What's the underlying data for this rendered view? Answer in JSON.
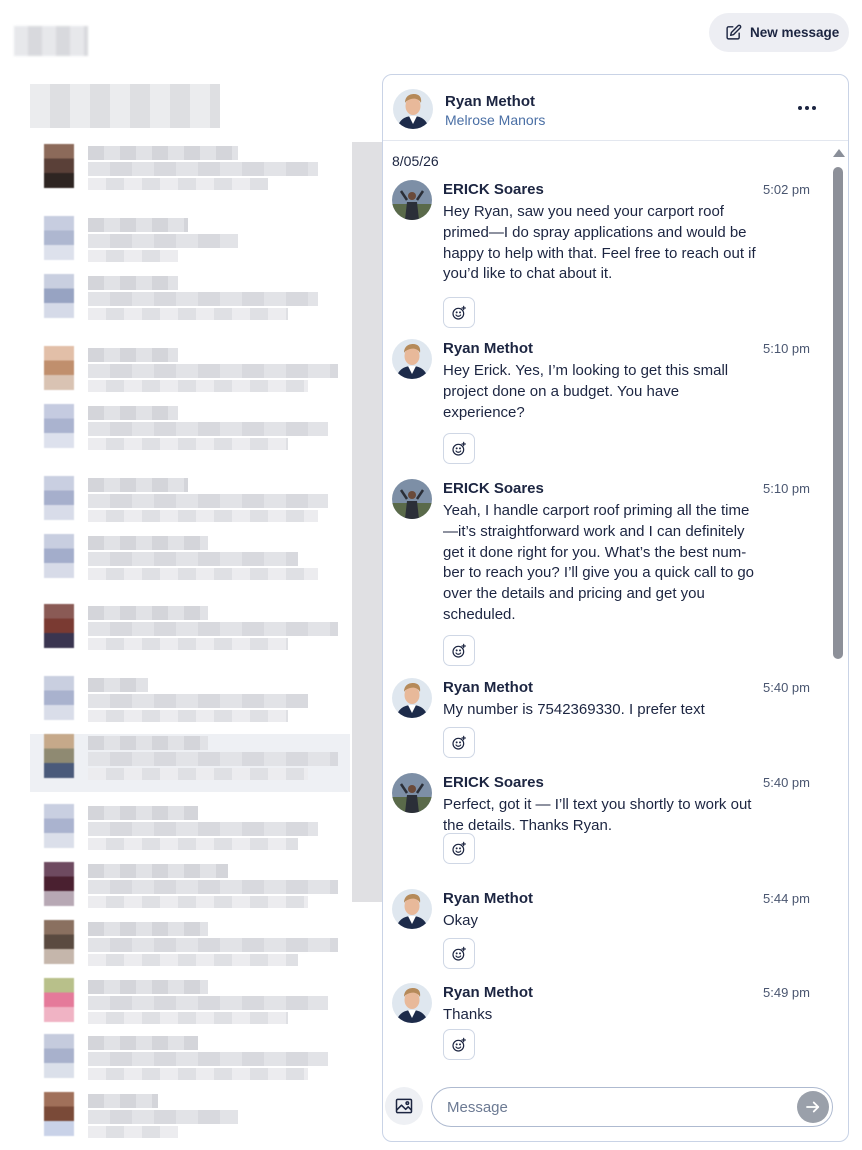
{
  "toolbar": {
    "new_message_label": "New message",
    "new_message_icon": "compose-icon"
  },
  "conversation": {
    "contact_name": "Ryan Methot",
    "contact_subtitle": "Melrose Manors",
    "more_icon": "more-horizontal-icon"
  },
  "thread": {
    "date": "8/05/26",
    "messages": [
      {
        "sender": "ERICK Soares",
        "time": "5:02 pm",
        "avatar": "erick-avatar",
        "text": "Hey Ryan, saw you need your carport roof primed—I do spray applications and would be happy to help with that. Feel free to reach out if you’d like to chat about it."
      },
      {
        "sender": "Ryan Methot",
        "time": "5:10 pm",
        "avatar": "ryan-avatar",
        "text": "Hey Erick. Yes, I’m looking to get this small project done on a budget. You have experience?"
      },
      {
        "sender": "ERICK Soares",
        "time": "5:10 pm",
        "avatar": "erick-avatar",
        "text": "Yeah, I handle carport roof priming all the time—it’s straightforward work and I can definitely get it done right for you. What’s the best num-ber to reach you? I’ll give you a quick call to go over the details and pricing and get you scheduled."
      },
      {
        "sender": "Ryan Methot",
        "time": "5:40 pm",
        "avatar": "ryan-avatar",
        "text": "My number is 7542369330. I prefer text"
      },
      {
        "sender": "ERICK Soares",
        "time": "5:40 pm",
        "avatar": "erick-avatar",
        "text": "Perfect, got it — I’ll text you shortly to work out the details. Thanks Ryan."
      },
      {
        "sender": "Ryan Methot",
        "time": "5:44 pm",
        "avatar": "ryan-avatar",
        "text": "Okay"
      },
      {
        "sender": "Ryan Methot",
        "time": "5:49 pm",
        "avatar": "ryan-avatar",
        "text": "Thanks"
      }
    ]
  },
  "composer": {
    "placeholder": "Message",
    "attach_icon": "image-icon",
    "send_icon": "send-arrow-icon"
  },
  "colors": {
    "accent": "#4a6fa5",
    "text": "#1c2541",
    "border": "#c9d3e6"
  }
}
